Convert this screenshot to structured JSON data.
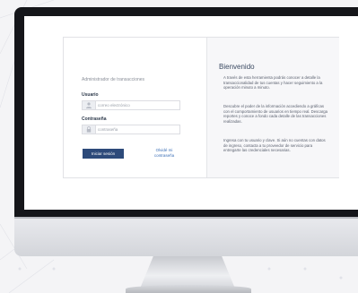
{
  "login": {
    "subtitle": "Administrador de transacciones",
    "username_label": "Usuario",
    "username_placeholder": "correo electrónico",
    "password_label": "Contraseña",
    "password_placeholder": "contraseña",
    "login_button": "Iniciar sesión",
    "forgot_password": "Olvidé mi contraseña"
  },
  "welcome": {
    "title": "Bienvenido",
    "paragraphs": [
      "A través de esta herramienta podrás conocer a detalle la transaccionalidad de tus cuentas y hacer seguimiento a la operación minuto a minuto.",
      "Descubre el poder de la información accediendo a gráficas con el comportamiento de usuarios en tiempo real. Descarga reportes y conoce a fondo cada detalle de las transacciones realizadas.",
      "Ingresa con tu usuario y clave. Si aún no cuentas con datos de ingreso, contacta a tu proveedor de servicio para entregarte las credenciales necesarias."
    ]
  },
  "colors": {
    "primary_button": "#2d4a7a",
    "link": "#3b6fb6"
  }
}
